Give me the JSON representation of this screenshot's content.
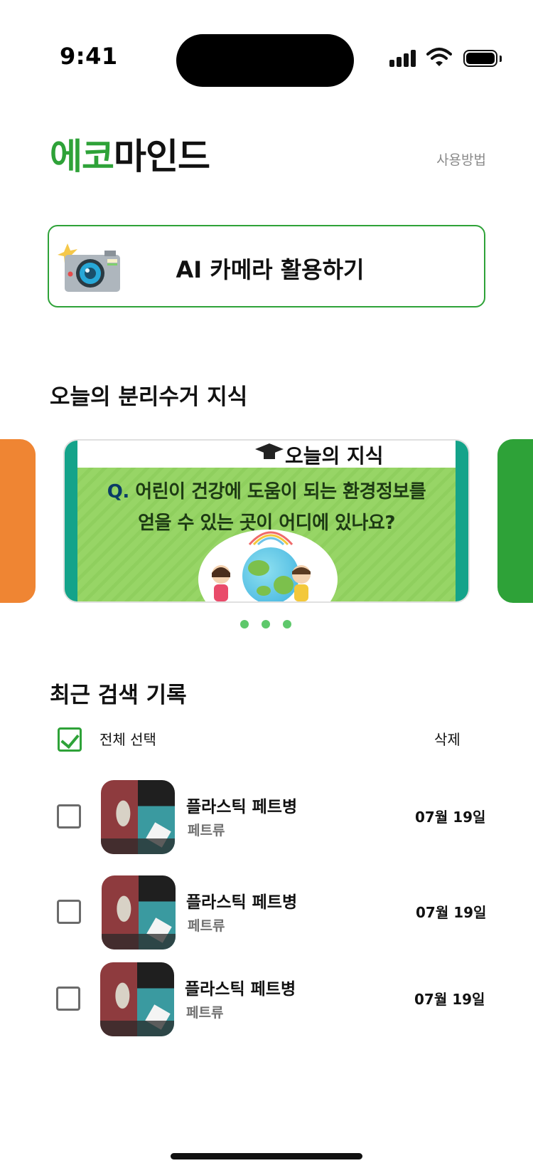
{
  "status_bar": {
    "time": "9:41"
  },
  "header": {
    "logo_green": "에코",
    "logo_black": "마인드",
    "help_link": "사용방법"
  },
  "ai_camera": {
    "label": "AI 카메라 활용하기",
    "icon": "camera-icon"
  },
  "knowledge": {
    "title": "오늘의 분리수거 지식",
    "card": {
      "tag": "오늘의 지식",
      "question_line1_mark": "Q.",
      "question_line1": "어린이 건강에 도움이 되는 환경정보를",
      "question_line2": "얻을 수 있는 곳이 어디에 있나요?"
    },
    "page_count": 3
  },
  "recent": {
    "title": "최근 검색 기록",
    "select_all_label": "전체 선택",
    "select_all_checked": true,
    "delete_label": "삭제",
    "items": [
      {
        "title": "플라스틱 페트병",
        "category": "페트류",
        "date": "07월 19일",
        "checked": false
      },
      {
        "title": "플라스틱 페트병",
        "category": "페트류",
        "date": "07월 19일",
        "checked": false
      },
      {
        "title": "플라스틱 페트병",
        "category": "페트류",
        "date": "07월 19일",
        "checked": false
      }
    ]
  },
  "colors": {
    "brand_green": "#2ea238",
    "accent_orange": "#ef8533",
    "dot_green": "#5ec86b"
  }
}
